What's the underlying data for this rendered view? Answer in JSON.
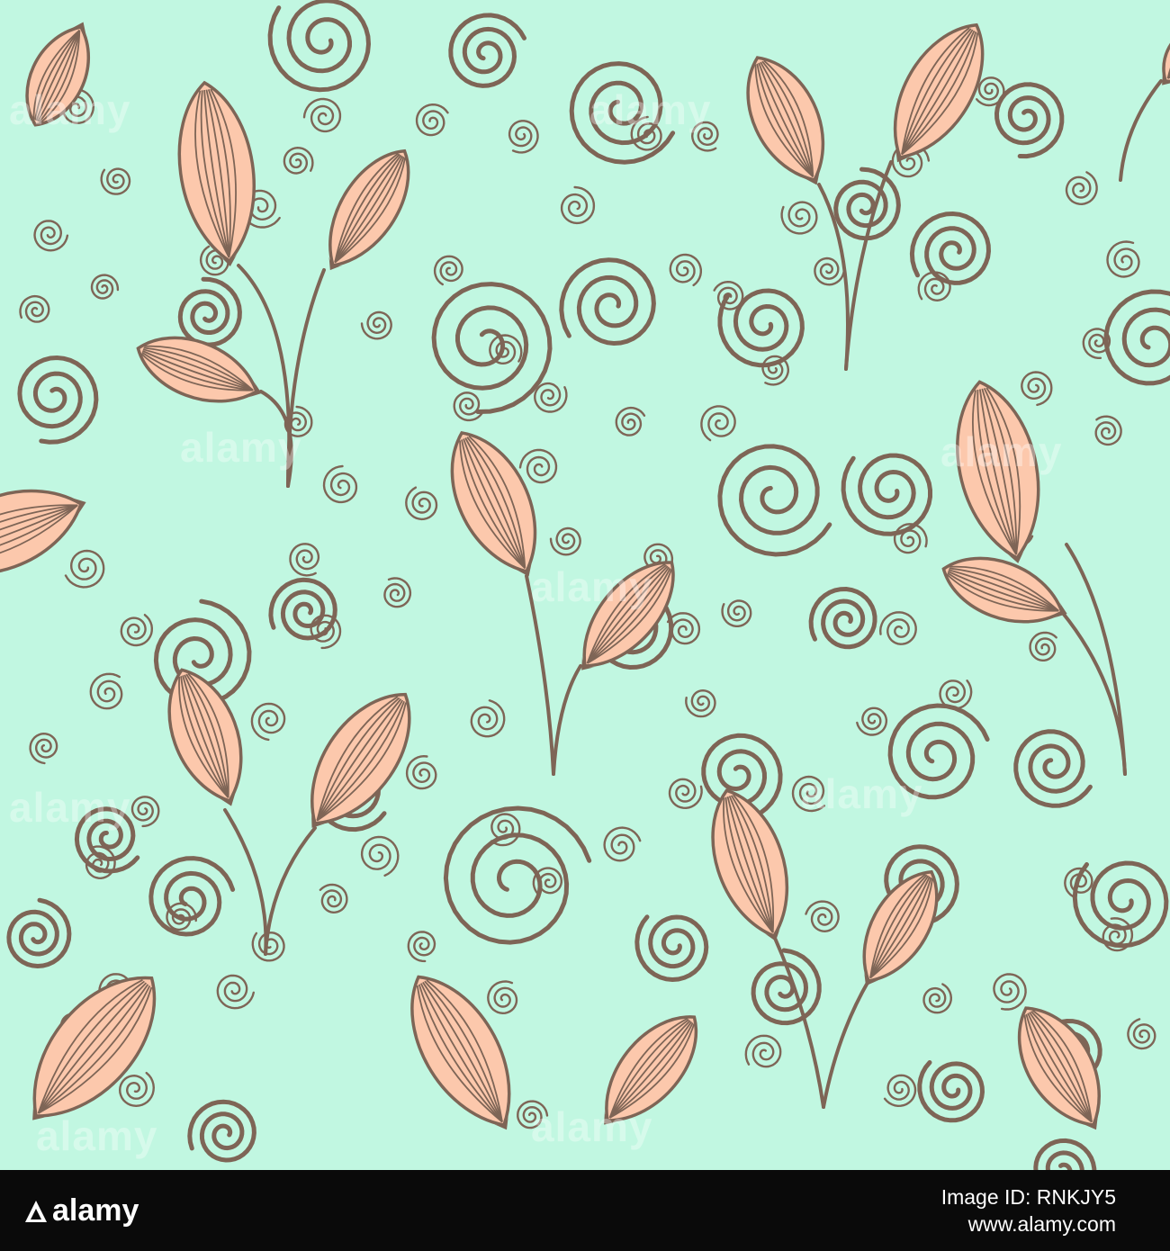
{
  "colors": {
    "background": "#c1f7e1",
    "leaf_fill": "#fcc8ac",
    "stroke": "#7e6556",
    "footer": "#0a0a0a"
  },
  "watermark": {
    "text": "alamy"
  },
  "footer": {
    "logo_text": "alamy",
    "image_id": "Image ID: RNKJY5",
    "url": "www.alamy.com"
  }
}
